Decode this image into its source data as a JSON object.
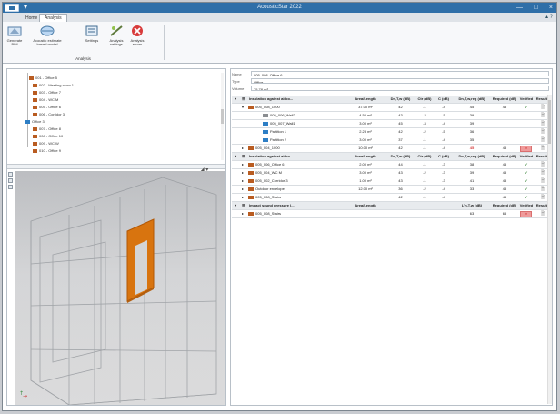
{
  "window": {
    "title": "AcousticStar 2022",
    "controls": [
      "—",
      "□",
      "×"
    ]
  },
  "tabs": [
    {
      "label": "Home",
      "active": false
    },
    {
      "label": "Analysis",
      "active": true
    }
  ],
  "tab_right": "▴ ?",
  "ribbon": {
    "group_label": "Analysis",
    "buttons": [
      {
        "label": "Generate\nBIM",
        "icon": "generate-icon"
      },
      {
        "label": "Acoustic estimate\nbased model",
        "icon": "acoustic-model-icon"
      },
      {
        "label": "Settings",
        "icon": "settings-icon"
      },
      {
        "label": "Analysis\nsettings",
        "icon": "analysis-icon"
      },
      {
        "label": "Analysis\nerrors",
        "icon": "error-icon"
      }
    ]
  },
  "tree": {
    "items": [
      {
        "label": "001 - Office 5",
        "indent": 12
      },
      {
        "label": "002 - Meeting room 1",
        "indent": 16
      },
      {
        "label": "003 - Office 7",
        "indent": 16
      },
      {
        "label": "004 - WC M",
        "indent": 16
      },
      {
        "label": "005 - Office 6",
        "indent": 16
      },
      {
        "label": "006 - Corridor 3",
        "indent": 16
      },
      {
        "label": "Office 3",
        "indent": 8
      },
      {
        "label": "007 - Office 8",
        "indent": 16
      },
      {
        "label": "008 - Office 10",
        "indent": 16
      },
      {
        "label": "009 - WC W",
        "indent": 16
      },
      {
        "label": "010 - Office 9",
        "indent": 16
      }
    ]
  },
  "view_tools": [
    "⌂",
    "⊞",
    "◉"
  ],
  "details": {
    "name_label": "Name",
    "name_value": "005_008_Office 6",
    "type_label": "Type",
    "type_value": "Office",
    "volume_label": "Volume",
    "volume_value": "75.78 m³"
  },
  "table": {
    "rows": [
      {
        "kind": "header",
        "cells": [
          "▾",
          "☰",
          "Insulation against airbo...",
          "Area/Length",
          "Dn,T,w (dB)",
          "Ctr (dB)",
          "C (dB)",
          "Dn,T,w,req (dB)",
          "Required (dB)",
          "Verified",
          "Results"
        ]
      },
      {
        "kind": "group",
        "cells": [
          "",
          "▾",
          "005_008_1000",
          "37.00 m²",
          "42",
          "-1",
          "-4",
          "45",
          "45",
          "✓",
          "🗎"
        ]
      },
      {
        "kind": "sub",
        "cells": [
          "",
          "",
          "005_006_Wall2",
          "4.50 m²",
          "43",
          "-2",
          "-5",
          "39",
          "",
          "",
          "🗎"
        ]
      },
      {
        "kind": "sub",
        "cells": [
          "",
          "",
          "005_007_Wall1",
          "3.00 m²",
          "45",
          "-3",
          "-4",
          "39",
          "",
          "",
          "🗎"
        ]
      },
      {
        "kind": "sub",
        "cells": [
          "",
          "",
          "Partition 1",
          "2.23 m²",
          "42",
          "-2",
          "-5",
          "36",
          "",
          "",
          "🗎"
        ]
      },
      {
        "kind": "sub",
        "cells": [
          "",
          "",
          "Partition 2",
          "3.00 m²",
          "37",
          "-1",
          "-4",
          "35",
          "",
          "",
          "🗎"
        ]
      },
      {
        "kind": "group",
        "cells": [
          "",
          "▸",
          "005_004_1000",
          "10.00 m²",
          "42",
          "-1",
          "-4",
          "45",
          "45",
          "×",
          "🗎"
        ]
      },
      {
        "kind": "header",
        "cells": [
          "▾",
          "☰",
          "Insulation against airbo...",
          "Area/Length",
          "Dn,T,w (dB)",
          "Ctr (dB)",
          "C (dB)",
          "Dn,T,w,req (dB)",
          "Required (dB)",
          "Verified",
          "Results"
        ]
      },
      {
        "kind": "group",
        "cells": [
          "",
          "▸",
          "005_006_Office 6",
          "2.00 m²",
          "44",
          "-1",
          "-3",
          "38",
          "45",
          "✓",
          "🗎"
        ]
      },
      {
        "kind": "group",
        "cells": [
          "",
          "▸",
          "005_004_WC M",
          "3.00 m²",
          "43",
          "-2",
          "-3",
          "39",
          "45",
          "✓",
          "🗎"
        ]
      },
      {
        "kind": "group",
        "cells": [
          "",
          "▸",
          "005_002_Corridor 3",
          "1.00 m²",
          "43",
          "-1",
          "-3",
          "41",
          "45",
          "✓",
          "🗎"
        ]
      },
      {
        "kind": "group",
        "cells": [
          "",
          "▸",
          "Outdoor envelope",
          "12.00 m²",
          "36",
          "-2",
          "-4",
          "33",
          "45",
          "✓",
          "🗎"
        ]
      },
      {
        "kind": "group",
        "cells": [
          "",
          "▸",
          "005_008_Stairs",
          "",
          "42",
          "-1",
          "-4",
          "",
          "45",
          "✓",
          "🗎"
        ]
      },
      {
        "kind": "header",
        "cells": [
          "▾",
          "☰",
          "Impact sound pressure l...",
          "Area/Length",
          "",
          "",
          "",
          "L'n,T,w (dB)",
          "Required (dB)",
          "Verified",
          "Results"
        ]
      },
      {
        "kind": "group",
        "cells": [
          "",
          "▸",
          "005_008_Stairs",
          "",
          "",
          "",
          "",
          "63",
          "65",
          "×",
          "🗎"
        ]
      }
    ]
  }
}
